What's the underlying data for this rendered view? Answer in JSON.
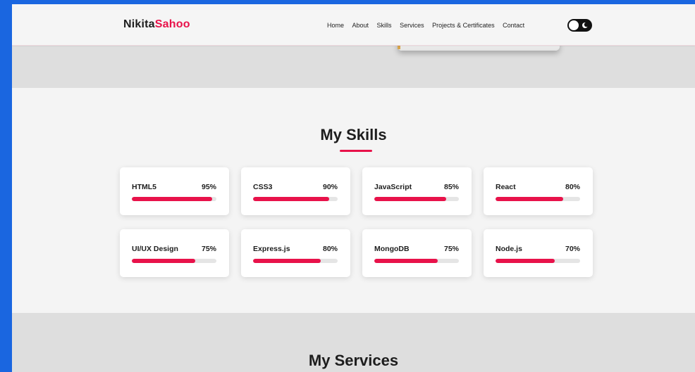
{
  "brand": {
    "first": "Nikita",
    "last": "Sahoo",
    "accent_color": "#e8124a"
  },
  "nav": {
    "links": [
      "Home",
      "About",
      "Skills",
      "Services",
      "Projects & Certificates",
      "Contact"
    ],
    "theme_toggle_icon": "moon-icon"
  },
  "skills": {
    "title": "My Skills",
    "items": [
      {
        "name": "HTML5",
        "percent_label": "95%",
        "level": 95
      },
      {
        "name": "CSS3",
        "percent_label": "90%",
        "level": 90
      },
      {
        "name": "JavaScript",
        "percent_label": "85%",
        "level": 85
      },
      {
        "name": "React",
        "percent_label": "80%",
        "level": 80
      },
      {
        "name": "UI/UX Design",
        "percent_label": "75%",
        "level": 75
      },
      {
        "name": "Express.js",
        "percent_label": "80%",
        "level": 80
      },
      {
        "name": "MongoDB",
        "percent_label": "75%",
        "level": 75
      },
      {
        "name": "Node.js",
        "percent_label": "70%",
        "level": 70
      }
    ]
  },
  "services": {
    "title": "My Services"
  }
}
